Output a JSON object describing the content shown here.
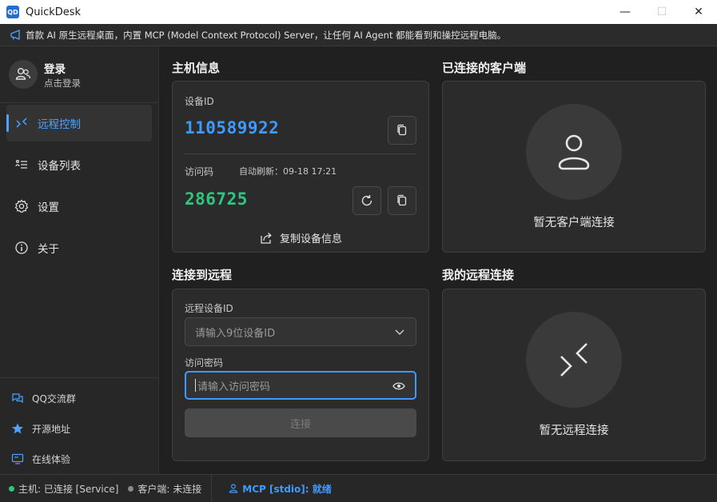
{
  "window": {
    "title": "QuickDesk",
    "app_icon_text": "QD",
    "minimize": "—",
    "maximize": "☐",
    "close": "✕"
  },
  "banner": {
    "text": "首款 AI 原生远程桌面，内置 MCP (Model Context Protocol) Server，让任何 AI Agent 都能看到和操控远程电脑。"
  },
  "sidebar": {
    "login_title": "登录",
    "login_subtitle": "点击登录",
    "items": [
      {
        "label": "远程控制",
        "icon": "remote-control-icon",
        "active": true
      },
      {
        "label": "设备列表",
        "icon": "device-list-icon",
        "active": false
      },
      {
        "label": "设置",
        "icon": "gear-icon",
        "active": false
      },
      {
        "label": "关于",
        "icon": "info-icon",
        "active": false
      }
    ],
    "footer": [
      {
        "label": "QQ交流群",
        "icon": "chat-icon"
      },
      {
        "label": "开源地址",
        "icon": "star-icon"
      },
      {
        "label": "在线体验",
        "icon": "monitor-icon"
      }
    ]
  },
  "host_info": {
    "title": "主机信息",
    "device_id_label": "设备ID",
    "device_id": "110589922",
    "access_code_label": "访问码",
    "auto_refresh": "自动刷新：09-18 17:21",
    "access_code": "286725",
    "copy_info_label": "复制设备信息"
  },
  "connected_clients": {
    "title": "已连接的客户端",
    "empty_text": "暂无客户端连接"
  },
  "connect_remote": {
    "title": "连接到远程",
    "remote_id_label": "远程设备ID",
    "remote_id_placeholder": "请输入9位设备ID",
    "password_label": "访问密码",
    "password_placeholder": "请输入访问密码",
    "connect_label": "连接"
  },
  "my_connections": {
    "title": "我的远程连接",
    "empty_text": "暂无远程连接"
  },
  "status": {
    "host": "主机: 已连接 [Service]",
    "client": "客户端: 未连接",
    "mcp": "MCP [stdio]: 就绪",
    "host_color": "#2ec77f",
    "client_color": "#8a8a8a",
    "accent": "#3d9bff"
  }
}
